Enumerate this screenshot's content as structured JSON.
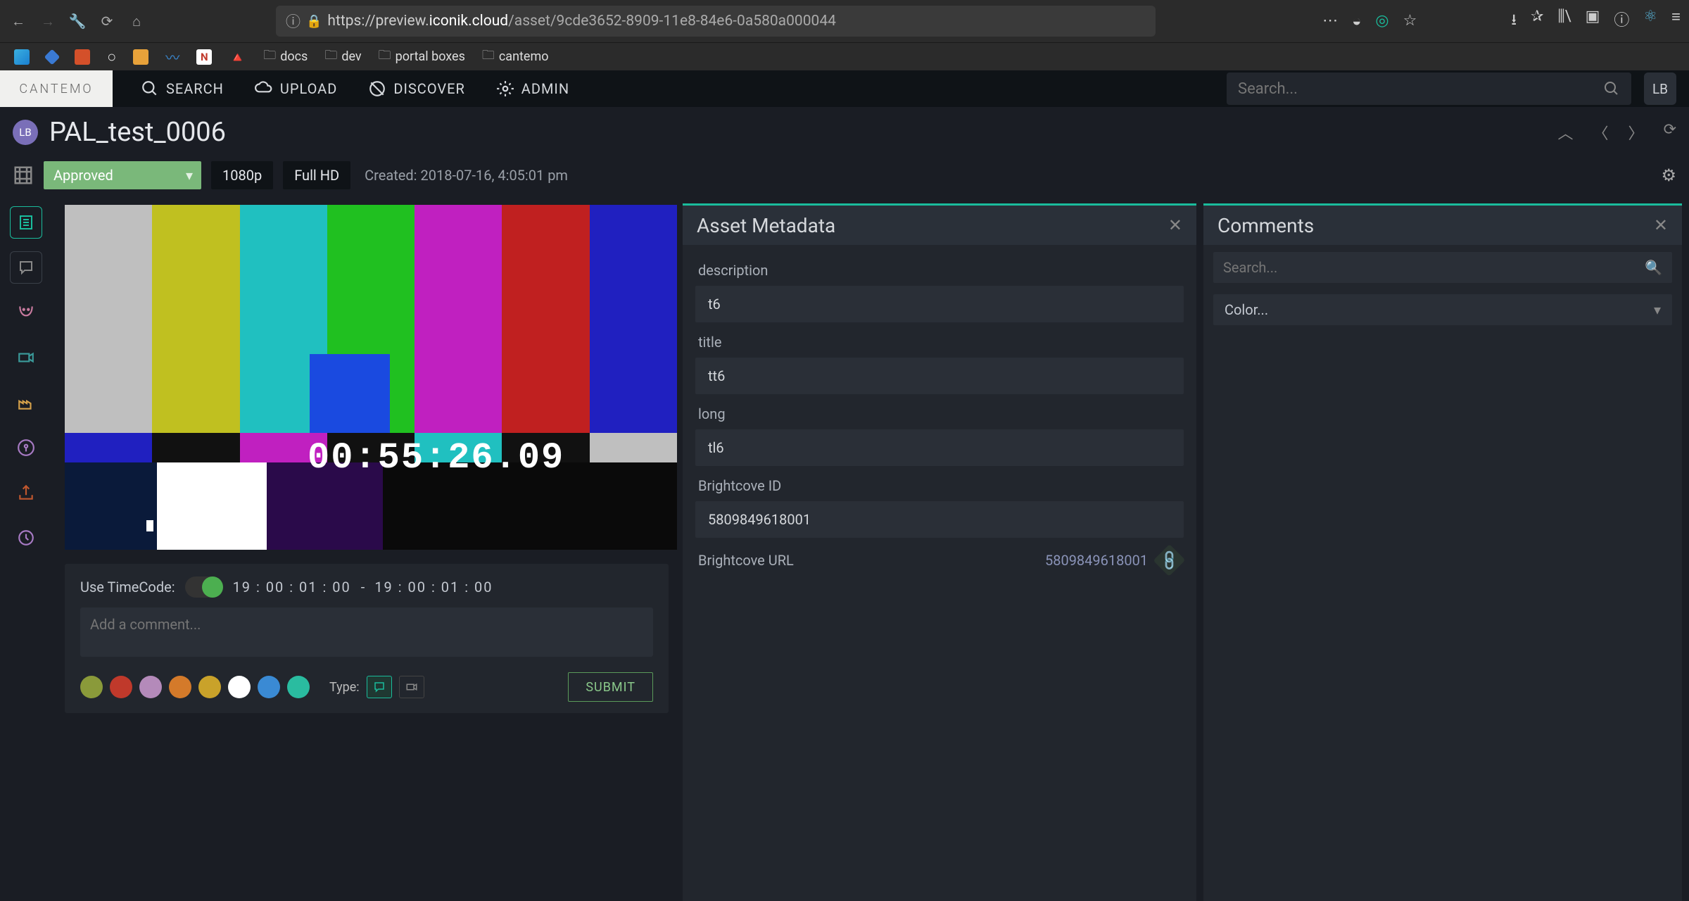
{
  "browser": {
    "url_prefix": "https://preview.",
    "url_domain": "iconik.cloud",
    "url_path": "/asset/9cde3652-8909-11e8-84e6-0a580a000044"
  },
  "bookmarks": [
    "docs",
    "dev",
    "portal boxes",
    "cantemo"
  ],
  "header": {
    "logo": "CANTEMO",
    "nav": {
      "search": "SEARCH",
      "upload": "UPLOAD",
      "discover": "DISCOVER",
      "admin": "ADMIN"
    },
    "search_placeholder": "Search...",
    "user_initials": "LB"
  },
  "asset": {
    "avatar_initials": "LB",
    "title": "PAL_test_0006",
    "status": "Approved",
    "resolution": "1080p",
    "format": "Full HD",
    "created_label": "Created: 2018-07-16, 4:05:01 pm",
    "timecode_overlay": "00:55:26.09"
  },
  "comment_ctrl": {
    "use_tc_label": "Use TimeCode:",
    "tc_start": "19 : 00 : 01 : 00",
    "tc_sep": "-",
    "tc_end": "19 : 00 : 01 : 00",
    "placeholder": "Add a comment...",
    "type_label": "Type:",
    "submit": "SUBMIT",
    "colors": [
      "#8a9a3a",
      "#c0392b",
      "#b48aba",
      "#d47a2a",
      "#c9a22a",
      "#ffffff",
      "#3a8ad4",
      "#2abca0"
    ]
  },
  "metadata": {
    "panel_title": "Asset Metadata",
    "fields": {
      "description": {
        "label": "description",
        "value": "t6"
      },
      "title": {
        "label": "title",
        "value": "tt6"
      },
      "long": {
        "label": "long",
        "value": "tl6"
      },
      "brightcove_id": {
        "label": "Brightcove ID",
        "value": "5809849618001"
      },
      "brightcove_url": {
        "label": "Brightcove URL",
        "value": "5809849618001"
      }
    }
  },
  "comments": {
    "panel_title": "Comments",
    "search_placeholder": "Search...",
    "color_filter": "Color..."
  }
}
